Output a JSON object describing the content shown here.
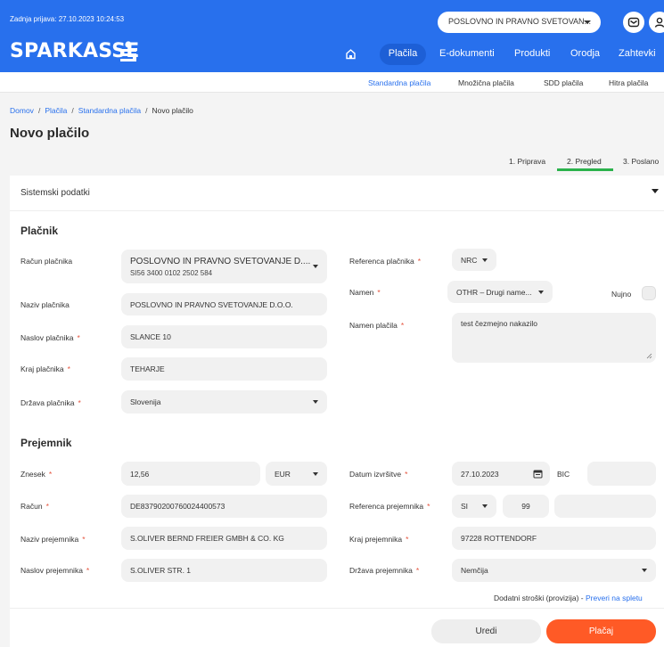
{
  "header": {
    "last_login": "Zadnja prijava: 27.10.2023 10:24:53",
    "company_select": "POSLOVNO IN PRAVNO SVETOVAN...",
    "logo": "SPARKASSE"
  },
  "mainnav": [
    "Plačila",
    "E-dokumenti",
    "Produkti",
    "Orodja",
    "Zahtevki"
  ],
  "subnav": [
    "Standardna plačila",
    "Množična plačila",
    "SDD plačila",
    "Hitra plačila"
  ],
  "breadcrumb": [
    "Domov",
    "Plačila",
    "Standardna plačila",
    "Novo plačilo"
  ],
  "page_title": "Novo plačilo",
  "steps": [
    "1. Priprava",
    "2. Pregled",
    "3. Poslano"
  ],
  "system_data_title": "Sistemski podatki",
  "payer": {
    "section_title": "Plačnik",
    "account_label": "Račun plačnika",
    "account_name": "POSLOVNO IN PRAVNO SVETOVANJE D....",
    "account_iban": "SI56 3400 0102 2502 584",
    "name_label": "Naziv plačnika",
    "name_value": "POSLOVNO IN PRAVNO SVETOVANJE D.O.O.",
    "address_label": "Naslov plačnika",
    "address_value": "SLANCE 10",
    "city_label": "Kraj plačnika",
    "city_value": "TEHARJE",
    "country_label": "Država plačnika",
    "country_value": "Slovenija",
    "reference_label": "Referenca plačnika",
    "reference_value": "NRC",
    "purpose_label": "Namen",
    "purpose_value": "OTHR – Drugi name...",
    "urgent_label": "Nujno",
    "purpose_text_label": "Namen plačila",
    "purpose_text_value": "test čezmejno nakazilo"
  },
  "recipient": {
    "section_title": "Prejemnik",
    "amount_label": "Znesek",
    "amount_value": "12,56",
    "currency_value": "EUR",
    "account_label": "Račun",
    "account_value": "DE83790200760024400573",
    "name_label": "Naziv prejemnika",
    "name_value": "S.OLIVER BERND FREIER GMBH & CO. KG",
    "address_label": "Naslov prejemnika",
    "address_value": "S.OLIVER STR. 1",
    "date_label": "Datum izvršitve",
    "date_value": "27.10.2023",
    "bic_label": "BIC",
    "bic_value": "",
    "reference_label": "Referenca prejemnika",
    "reference_model": "SI",
    "reference_code": "99",
    "reference_value": "",
    "city_label": "Kraj prejemnika",
    "city_value": "97228 ROTTENDORF",
    "country_label": "Država prejemnika",
    "country_value": "Nemčija"
  },
  "footer": {
    "fees_text": "Dodatni stroški (provizija) -",
    "fees_link": "Preveri na spletu",
    "edit_button": "Uredi",
    "pay_button": "Plačaj"
  },
  "colors": {
    "brand_blue": "#2870ed",
    "accent_orange": "#ff5a26",
    "step_green": "#2bb24c",
    "required_red": "#e5533d"
  }
}
